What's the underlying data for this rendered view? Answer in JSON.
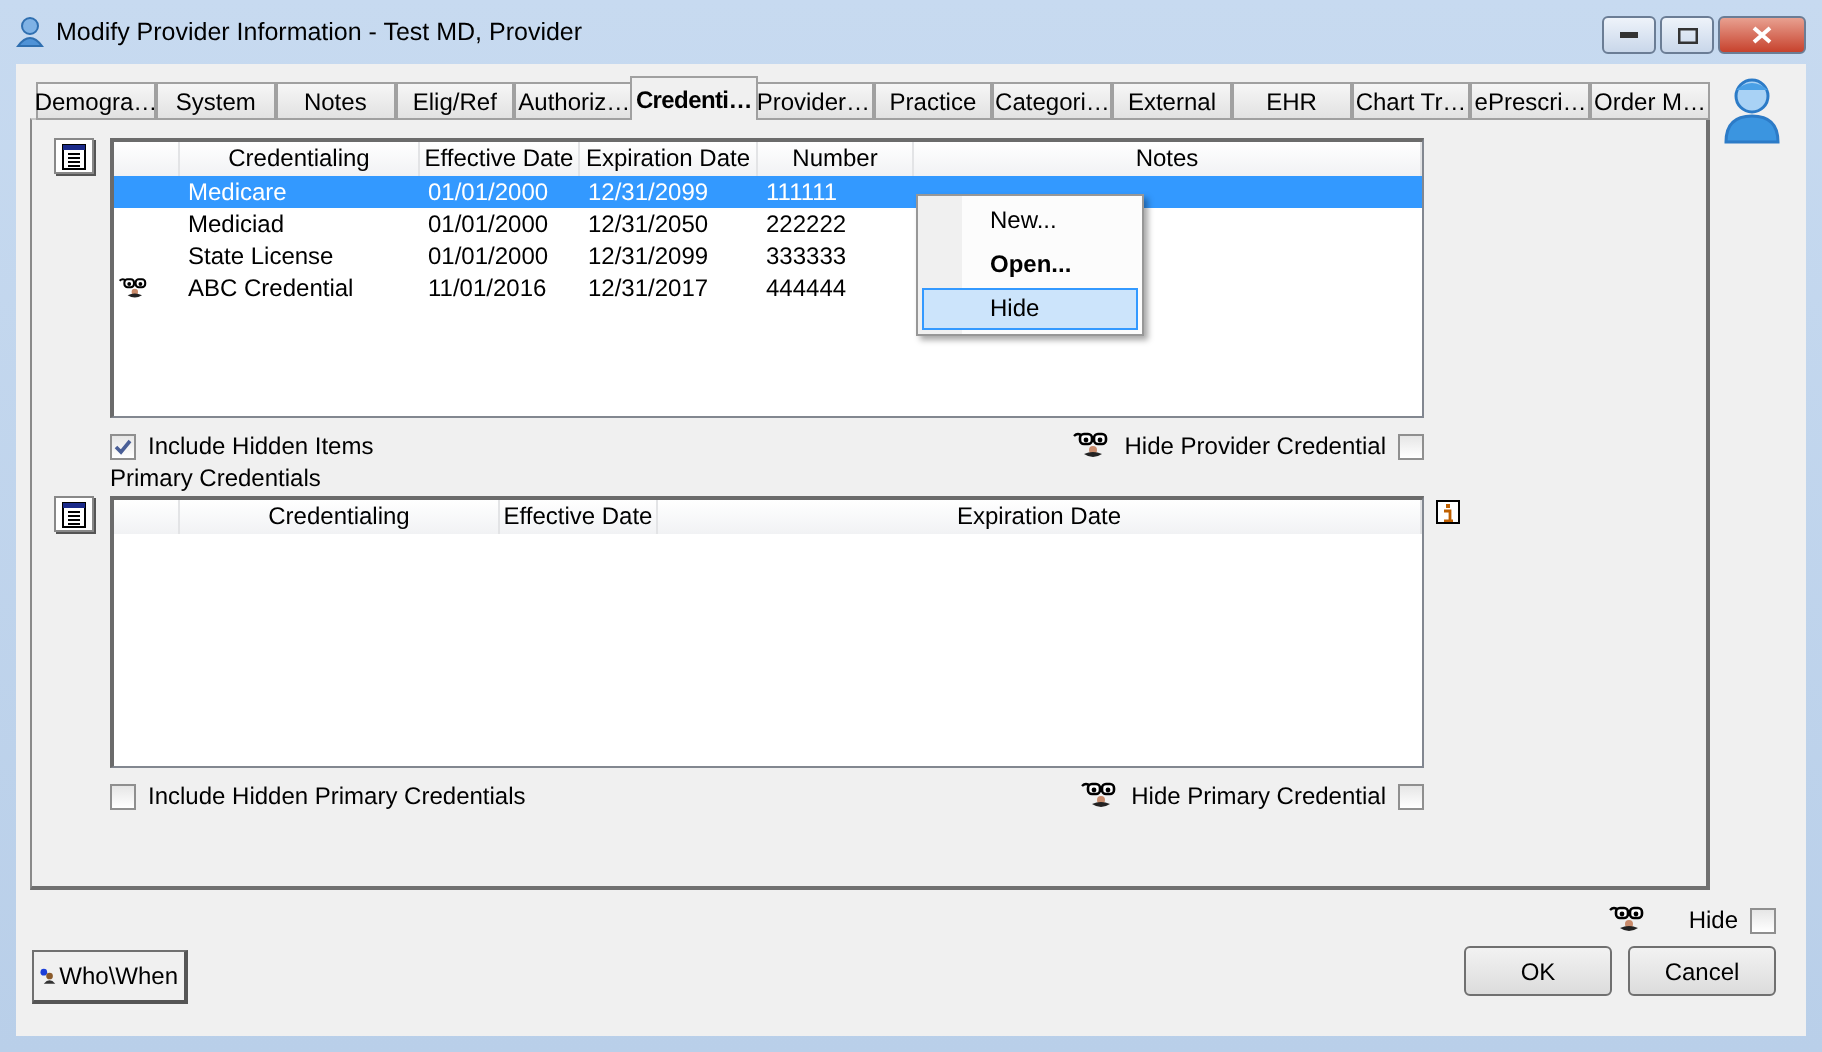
{
  "window": {
    "title": "Modify Provider Information - Test MD, Provider"
  },
  "tabs": [
    {
      "label": "Demogra…",
      "selected": false
    },
    {
      "label": "System",
      "selected": false
    },
    {
      "label": "Notes",
      "selected": false
    },
    {
      "label": "Elig/Ref",
      "selected": false
    },
    {
      "label": "Authoriz…",
      "selected": false
    },
    {
      "label": "Credenti…",
      "selected": true
    },
    {
      "label": "Provider…",
      "selected": false
    },
    {
      "label": "Practice",
      "selected": false
    },
    {
      "label": "Categori…",
      "selected": false
    },
    {
      "label": "External",
      "selected": false
    },
    {
      "label": "EHR",
      "selected": false
    },
    {
      "label": "Chart Tr…",
      "selected": false
    },
    {
      "label": "ePrescri…",
      "selected": false
    },
    {
      "label": "Order M…",
      "selected": false
    }
  ],
  "credentials_table": {
    "columns": [
      "Credentialing",
      "Effective Date",
      "Expiration Date",
      "Number",
      "Notes"
    ],
    "rows": [
      {
        "hidden": false,
        "selected": true,
        "cells": [
          "Medicare",
          "01/01/2000",
          "12/31/2099",
          "111111",
          ""
        ]
      },
      {
        "hidden": false,
        "selected": false,
        "cells": [
          "Mediciad",
          "01/01/2000",
          "12/31/2050",
          "222222",
          ""
        ]
      },
      {
        "hidden": false,
        "selected": false,
        "cells": [
          "State License",
          "01/01/2000",
          "12/31/2099",
          "333333",
          ""
        ]
      },
      {
        "hidden": true,
        "selected": false,
        "cells": [
          "ABC Credential",
          "11/01/2016",
          "12/31/2017",
          "444444",
          ""
        ]
      }
    ]
  },
  "context_menu": {
    "items": [
      {
        "label": "New...",
        "default": false,
        "selected": false
      },
      {
        "label": "Open...",
        "default": true,
        "selected": false
      },
      {
        "label": "Hide",
        "default": false,
        "selected": true
      }
    ]
  },
  "include_hidden_items": {
    "label": "Include Hidden Items",
    "checked": true
  },
  "hide_provider_credential": {
    "label": "Hide Provider Credential",
    "checked": false
  },
  "primary_credentials": {
    "title": "Primary Credentials",
    "columns": [
      "Credentialing",
      "Effective Date",
      "Expiration Date"
    ]
  },
  "include_hidden_primary_credentials": {
    "label": "Include Hidden Primary Credentials",
    "checked": false
  },
  "hide_primary_credential": {
    "label": "Hide Primary Credential",
    "checked": false
  },
  "hide": {
    "label": "Hide",
    "checked": false
  },
  "buttons": {
    "who_when": "Who\\When",
    "ok": "OK",
    "cancel": "Cancel"
  }
}
